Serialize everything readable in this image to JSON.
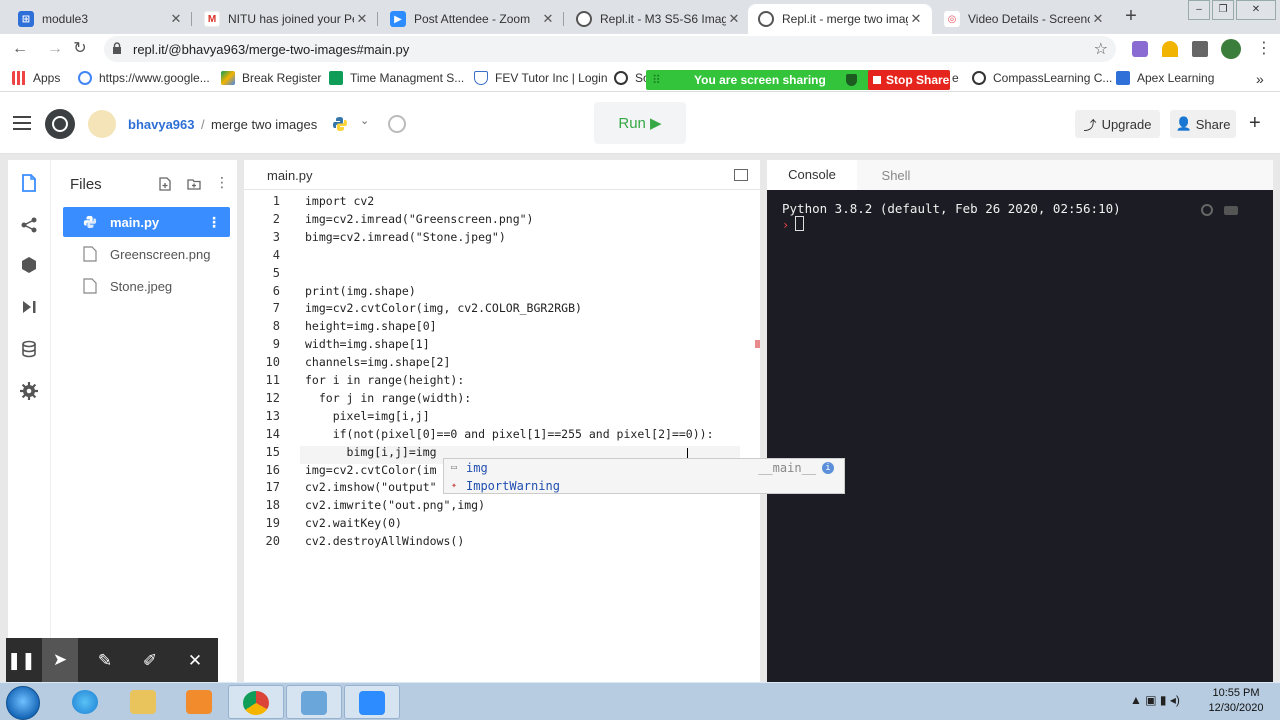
{
  "browser": {
    "tabs": [
      {
        "title": "module3"
      },
      {
        "title": "NITU has joined your Per"
      },
      {
        "title": "Post Attendee - Zoom"
      },
      {
        "title": "Repl.it - M3 S5-S6 Image"
      },
      {
        "title": "Repl.it - merge two imag"
      },
      {
        "title": "Video Details - Screenca"
      }
    ],
    "url": "repl.it/@bhavya963/merge-two-images#main.py",
    "bookmarks": [
      {
        "label": "Apps"
      },
      {
        "label": "https://www.google..."
      },
      {
        "label": "Break Register"
      },
      {
        "label": "Time Managment S..."
      },
      {
        "label": "FEV Tutor Inc | Login"
      },
      {
        "label": "So"
      },
      {
        "label": "e"
      },
      {
        "label": "CompassLearning C..."
      },
      {
        "label": "Apex Learning"
      }
    ],
    "screen_share": {
      "message": "You are screen sharing",
      "stop_label": "Stop Share"
    }
  },
  "repl": {
    "username": "bhavya963",
    "project": "merge two images",
    "run_label": "Run ▶",
    "upgrade_label": "Upgrade",
    "share_label": "Share",
    "files_title": "Files",
    "files": [
      {
        "name": "main.py"
      },
      {
        "name": "Greenscreen.png"
      },
      {
        "name": "Stone.jpeg"
      }
    ],
    "editor_tab": "main.py",
    "code_lines": [
      "import cv2",
      "img=cv2.imread(\"Greenscreen.png\")",
      "bimg=cv2.imread(\"Stone.jpeg\")",
      "",
      "",
      "print(img.shape)",
      "img=cv2.cvtColor(img, cv2.COLOR_BGR2RGB)",
      "height=img.shape[0]",
      "width=img.shape[1]",
      "channels=img.shape[2]",
      "for i in range(height):",
      "  for j in range(width):",
      "    pixel=img[i,j]",
      "    if(not(pixel[0]==0 and pixel[1]==255 and pixel[2]==0)):",
      "      bimg[i,j]=img",
      "img=cv2.cvtColor(im",
      "cv2.imshow(\"output\"",
      "cv2.imwrite(\"out.png\",img)",
      "cv2.waitKey(0)",
      "cv2.destroyAllWindows()"
    ],
    "line_numbers": [
      "1",
      "2",
      "3",
      "4",
      "5",
      "6",
      "7",
      "8",
      "9",
      "10",
      "11",
      "12",
      "13",
      "14",
      "15",
      "16",
      "17",
      "18",
      "19",
      "20"
    ],
    "autocomplete": [
      {
        "label": "img",
        "module": "__main__"
      },
      {
        "label": "ImportWarning",
        "module": ""
      }
    ],
    "console_tabs": [
      "Console",
      "Shell"
    ],
    "console_output": "Python 3.8.2 (default, Feb 26 2020, 02:56:10)",
    "console_prompt": "›"
  },
  "taskbar": {
    "time": "10:55 PM",
    "date": "12/30/2020"
  },
  "colors": {
    "repl_blue": "#3a8dff",
    "run_green": "#36a845",
    "console_bg": "#1c1c24",
    "share_green": "#33c43b",
    "stop_red": "#e5251d"
  },
  "icons": [
    "hamburger-icon",
    "replit-logo-icon",
    "python-icon",
    "history-icon",
    "files-icon",
    "share-nodes-icon",
    "packages-icon",
    "debugger-icon",
    "database-icon",
    "settings-icon",
    "new-file-icon",
    "new-folder-icon",
    "kebab-icon",
    "search-icon",
    "clear-icon",
    "pause-icon",
    "pointer-icon",
    "pen-icon",
    "highlighter-icon",
    "close-icon"
  ]
}
